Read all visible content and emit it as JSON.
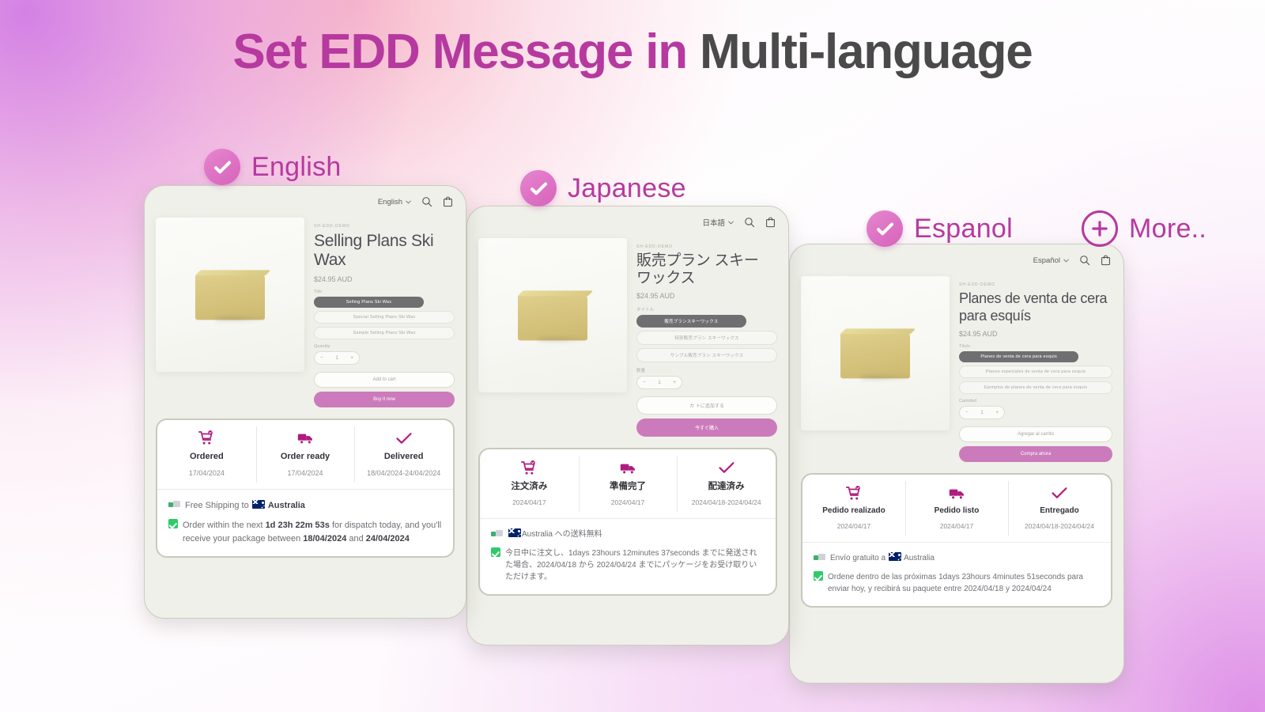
{
  "headline": {
    "accent_part": "Set EDD Message in ",
    "plain_part": "Multi-language"
  },
  "language_labels": [
    {
      "name": "English",
      "icon": "check-circle-icon"
    },
    {
      "name": "Japanese",
      "icon": "check-circle-icon"
    },
    {
      "name": "Espanol",
      "icon": "check-circle-icon"
    },
    {
      "name": "More..",
      "icon": "plus-circle-icon"
    }
  ],
  "colors": {
    "accent_magenta": "#b6399f",
    "headline_gray": "#4a4a4a",
    "badge_pink": "#dd72c4",
    "buy_button": "#cb7bbb",
    "device_bg": "#eff0e9",
    "step_icon": "#b01b7f",
    "check_green": "#2fca6a"
  },
  "cards": {
    "english": {
      "header": {
        "language_selector": "English",
        "chevron": "⌄",
        "search_icon": "search-icon",
        "bag_icon": "shopping-bag-icon"
      },
      "product": {
        "vendor": "SH-EDD-DEMO",
        "title": "Selling Plans Ski Wax",
        "price": "$24.95 AUD",
        "option_label": "Title",
        "variants": [
          "Selling Plans Ski Wax",
          "Special Selling Plans Ski Wax",
          "Sample Selling Plans Ski Wax"
        ],
        "quantity_label": "Quantity",
        "quantity_minus": "−",
        "quantity_value": "1",
        "quantity_plus": "+",
        "add_to_cart": "Add to cart",
        "buy_now": "Buy it now"
      },
      "edd": {
        "steps": [
          {
            "icon": "cart-icon",
            "name": "Ordered",
            "date": "17/04/2024"
          },
          {
            "icon": "truck-icon",
            "name": "Order ready",
            "date": "17/04/2024"
          },
          {
            "icon": "check-icon",
            "name": "Delivered",
            "date": "18/04/2024-24/04/2024"
          }
        ],
        "shipping_line": "Free Shipping to ",
        "shipping_country": "Australia",
        "message_pre": "Order within the next ",
        "message_countdown": "1d 23h 22m 53s",
        "message_mid": " for dispatch today, and you'll receive your package between ",
        "message_date_from": "18/04/2024",
        "message_conjunction": " and ",
        "message_date_to": "24/04/2024"
      }
    },
    "japanese": {
      "header": {
        "language_selector": "日本語",
        "chevron": "⌄",
        "search_icon": "search-icon",
        "bag_icon": "shopping-bag-icon"
      },
      "product": {
        "vendor": "SH-EDD-DEMO",
        "title": "販売プラン スキー ワックス",
        "price": "$24.95 AUD",
        "option_label": "タイトル",
        "variants": [
          "販売プランスキーワックス",
          "特別販売プラン スキーワックス",
          "サンプル販売プラン スキーワックス"
        ],
        "quantity_label": "数量",
        "quantity_minus": "−",
        "quantity_value": "1",
        "quantity_plus": "+",
        "add_to_cart": "カ トに追加する",
        "buy_now": "今すぐ購入"
      },
      "edd": {
        "steps": [
          {
            "icon": "cart-icon",
            "name": "注文済み",
            "date": "2024/04/17"
          },
          {
            "icon": "truck-icon",
            "name": "準備完了",
            "date": "2024/04/17"
          },
          {
            "icon": "check-icon",
            "name": "配達済み",
            "date": "2024/04/18-2024/04/24"
          }
        ],
        "shipping_country": "Australia",
        "shipping_suffix": " への送料無料",
        "message": "今日中に注文し、1days 23hours 12minutes 37seconds までに発送された場合、2024/04/18 から 2024/04/24 までにパッケージをお受け取りいただけます。"
      }
    },
    "espanol": {
      "header": {
        "language_selector": "Español",
        "chevron": "⌄",
        "search_icon": "search-icon",
        "bag_icon": "shopping-bag-icon"
      },
      "product": {
        "vendor": "SH-EDD-DEMO",
        "title": "Planes de venta de cera para esquís",
        "price": "$24.95 AUD",
        "option_label": "Título",
        "variants": [
          "Planes de venta de cera para esquís",
          "Planes especiales de venta de cera para esquís",
          "Ejemplos de planes de venta de cera para esquís"
        ],
        "quantity_label": "Cantidad",
        "quantity_minus": "−",
        "quantity_value": "1",
        "quantity_plus": "+",
        "add_to_cart": "Agregar al carrito",
        "buy_now": "Compra ahora"
      },
      "edd": {
        "steps": [
          {
            "icon": "cart-icon",
            "name": "Pedido realizado",
            "date": "2024/04/17"
          },
          {
            "icon": "truck-icon",
            "name": "Pedido listo",
            "date": "2024/04/17"
          },
          {
            "icon": "check-icon",
            "name": "Entregado",
            "date": "2024/04/18-2024/04/24"
          }
        ],
        "shipping_line": "Envío gratuito a ",
        "shipping_country": "Australia",
        "message": "Ordene dentro de las próximas 1days 23hours 4minutes 51seconds para enviar hoy, y recibirá su paquete entre 2024/04/18 y 2024/04/24"
      }
    }
  }
}
